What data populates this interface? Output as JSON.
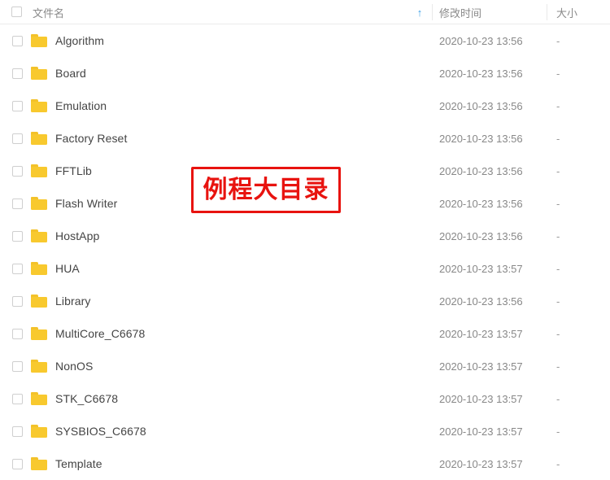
{
  "header": {
    "select_all_checkbox": "",
    "columns": [
      {
        "key": "name",
        "label": "文件名"
      },
      {
        "key": "mtime",
        "label": "修改时间"
      },
      {
        "key": "size",
        "label": "大小"
      }
    ],
    "name_label": "文件名",
    "time_label": "修改时间",
    "size_label": "大小",
    "sort_arrow": "↑",
    "sort_arrow_color": "#3ca0e8",
    "sorted_column": "name",
    "sort_direction": "asc"
  },
  "colors": {
    "folder": "#f8c92e",
    "folder_tab": "#f3c22a",
    "annotation": "#e8130f",
    "header_text": "#888888",
    "file_text": "#444444"
  },
  "rows": [
    {
      "name": "Algorithm",
      "icon": "folder-icon",
      "mtime": "2020-10-23 13:56",
      "size": "-"
    },
    {
      "name": "Board",
      "icon": "folder-icon",
      "mtime": "2020-10-23 13:56",
      "size": "-"
    },
    {
      "name": "Emulation",
      "icon": "folder-icon",
      "mtime": "2020-10-23 13:56",
      "size": "-"
    },
    {
      "name": "Factory Reset",
      "icon": "folder-icon",
      "mtime": "2020-10-23 13:56",
      "size": "-"
    },
    {
      "name": "FFTLib",
      "icon": "folder-icon",
      "mtime": "2020-10-23 13:56",
      "size": "-"
    },
    {
      "name": "Flash Writer",
      "icon": "folder-icon",
      "mtime": "2020-10-23 13:56",
      "size": "-"
    },
    {
      "name": "HostApp",
      "icon": "folder-icon",
      "mtime": "2020-10-23 13:56",
      "size": "-"
    },
    {
      "name": "HUA",
      "icon": "folder-icon",
      "mtime": "2020-10-23 13:57",
      "size": "-"
    },
    {
      "name": "Library",
      "icon": "folder-icon",
      "mtime": "2020-10-23 13:56",
      "size": "-"
    },
    {
      "name": "MultiCore_C6678",
      "icon": "folder-icon",
      "mtime": "2020-10-23 13:57",
      "size": "-"
    },
    {
      "name": "NonOS",
      "icon": "folder-icon",
      "mtime": "2020-10-23 13:57",
      "size": "-"
    },
    {
      "name": "STK_C6678",
      "icon": "folder-icon",
      "mtime": "2020-10-23 13:57",
      "size": "-"
    },
    {
      "name": "SYSBIOS_C6678",
      "icon": "folder-icon",
      "mtime": "2020-10-23 13:57",
      "size": "-"
    },
    {
      "name": "Template",
      "icon": "folder-icon",
      "mtime": "2020-10-23 13:57",
      "size": "-"
    }
  ],
  "annotation": {
    "text": "例程大目录"
  }
}
